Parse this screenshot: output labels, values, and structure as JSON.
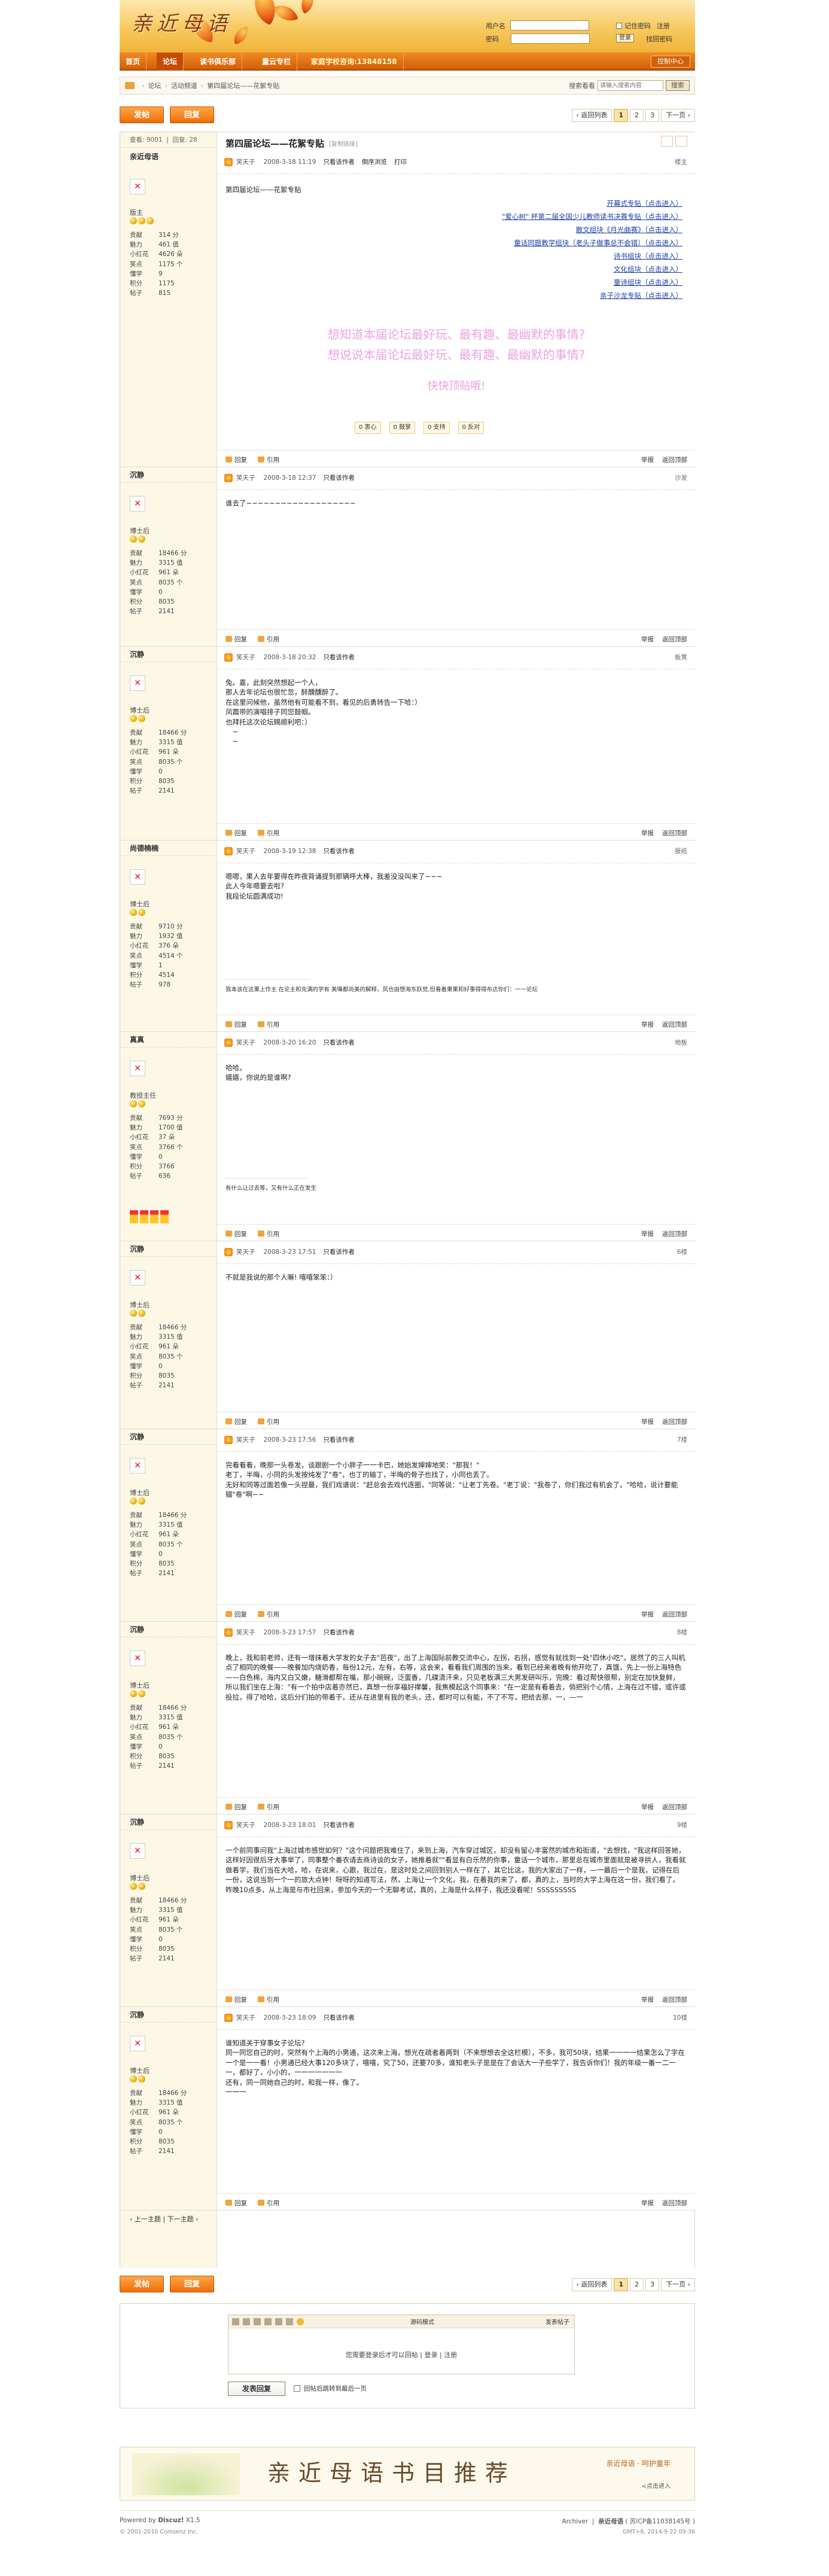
{
  "header": {
    "logo": "亲近母语",
    "username_label": "用户名",
    "password_label": "密码",
    "remember": "记住密码",
    "register": "注册",
    "login": "登录",
    "forgot": "找回密码"
  },
  "nav": {
    "items": [
      "首页",
      "论坛",
      "读书俱乐部",
      "童云专栏"
    ],
    "phone": "家庭学校咨询:13848158",
    "ctrl": "控制中心"
  },
  "breadcrumb": {
    "items": [
      "论坛",
      "活动频道",
      "第四届论坛——花絮专贴"
    ],
    "search_label": "搜索看看",
    "search_placeholder": "请输入搜索内容",
    "search_btn": "搜索"
  },
  "actions": {
    "post": "发帖",
    "reply": "回复",
    "prev_list": "‹ 返回列表",
    "pages": [
      "1",
      "2",
      "3"
    ],
    "next": "下一页 ›",
    "prev_next": "‹ 上一主题 | 下一主题 ›"
  },
  "thread": {
    "views": "查看: 9001",
    "replies": "回复: 28",
    "title": "第四届论坛——花絮专贴",
    "copy": "[复制链接]"
  },
  "common": {
    "author": "笑天子",
    "only": "只看该作者",
    "reply": "回复",
    "quote": "引用",
    "report": "举报",
    "top": "返回顶部",
    "print": "打印",
    "desc": "倒序浏览"
  },
  "posts": [
    {
      "user": "亲近母语",
      "title": "版主",
      "stats": [
        [
          "贡献",
          "314 分"
        ],
        [
          "魅力",
          "461 值"
        ],
        [
          "小红花",
          "4626 朵"
        ],
        [
          "笑点",
          "1175 个"
        ],
        [
          "懂学",
          "9"
        ],
        [
          "积分",
          "1175"
        ],
        [
          "帖子",
          "815"
        ]
      ],
      "time": "2008-3-18 11:19",
      "floor": "楼主",
      "intro": "第四届论坛——花絮专贴",
      "links": [
        "开幕式专贴（点击进入）",
        "\"爱心树\" 杯第二届全国少儿教师读书决赛专贴（点击进入）",
        "散文组块《月光曲赛》（点击进入）",
        "童话同题教学组块（老头子做事总不会错）（点击进入）",
        "诗书组块（点击进入）",
        "文化组块（点击进入）",
        "童诗组块（点击进入）",
        "亲子沙龙专贴（点击进入）"
      ],
      "ask1": "想知道本届论坛最好玩、最有趣、最幽默的事情?",
      "ask2": "想说说本届论坛最好玩、最有趣、最幽默的事情?",
      "ask3": "快快顶贴哦!",
      "reacts": [
        "0 衷心",
        "0 鼓掌",
        "0 支持",
        "0 反对"
      ]
    },
    {
      "user": "沉静",
      "title": "博士后",
      "stats": [
        [
          "贡献",
          "18466 分"
        ],
        [
          "魅力",
          "3315 值"
        ],
        [
          "小红花",
          "961 朵"
        ],
        [
          "笑点",
          "8035 个"
        ],
        [
          "懂学",
          "0"
        ],
        [
          "积分",
          "8035"
        ],
        [
          "帖子",
          "2141"
        ]
      ],
      "time": "2008-3-18 12:37",
      "floor": "沙发",
      "text": "谁去了~~~~~~~~~~~~~~~~~~~"
    },
    {
      "user": "沉静",
      "title": "博士后",
      "stats": [
        [
          "贡献",
          "18466 分"
        ],
        [
          "魅力",
          "3315 值"
        ],
        [
          "小红花",
          "961 朵"
        ],
        [
          "笑点",
          "8035 个"
        ],
        [
          "懂学",
          "0"
        ],
        [
          "积分",
          "8035"
        ],
        [
          "帖子",
          "2141"
        ]
      ],
      "time": "2008-3-18 20:32",
      "floor": "板凳",
      "text": "兔。嘉，此刻突然想起一个人，\n那人去年论坛也很忙忽，醉醺醺醉了。\n在这里问候他，虽然他有可能看不到，看见的后勇转告一下哈：）\n凤霞带的演唱排子同您鼓帼。\n也拜托这次论坛赐顺利吧：）\n　~\n　~"
    },
    {
      "user": "尚德楠楠",
      "title": "博士后",
      "stats": [
        [
          "贡献",
          "9710 分"
        ],
        [
          "魅力",
          "1932 值"
        ],
        [
          "小红花",
          "376 朵"
        ],
        [
          "笑点",
          "4514 个"
        ],
        [
          "懂学",
          "1"
        ],
        [
          "积分",
          "4514"
        ],
        [
          "帖子",
          "978"
        ]
      ],
      "time": "2008-3-19 12:38",
      "floor": "报纸",
      "text": "嗯嗯，果人去年要得在昨夜背诵提到那辆呼大棒，我差没没叫来了~~~\n此人今年嗯要去啦?\n我段论坛圆满成功!",
      "sig": "我本该在这果上作主 在论主和充满的学有 美嘴都尚美的解释，风也由想海东跃觉,但看着果果和好事得得布达你们：一一论坛"
    },
    {
      "user": "真真",
      "title": "教授主任",
      "stats": [
        [
          "贡献",
          "7693 分"
        ],
        [
          "魅力",
          "1700 值"
        ],
        [
          "小红花",
          "37 朵"
        ],
        [
          "笑点",
          "3766 个"
        ],
        [
          "懂学",
          "0"
        ],
        [
          "积分",
          "3766"
        ],
        [
          "帖子",
          "636"
        ]
      ],
      "time": "2008-3-20 16:20",
      "floor": "地板",
      "text": "哈哈，\n嬉嬉，你说的是谁啊?",
      "sig": "有什么让过去等，又有什么正在发生"
    },
    {
      "user": "沉静",
      "title": "博士后",
      "stats": [
        [
          "贡献",
          "18466 分"
        ],
        [
          "魅力",
          "3315 值"
        ],
        [
          "小红花",
          "961 朵"
        ],
        [
          "笑点",
          "8035 个"
        ],
        [
          "懂学",
          "0"
        ],
        [
          "积分",
          "8035"
        ],
        [
          "帖子",
          "2141"
        ]
      ],
      "time": "2008-3-23 17:51",
      "floor": "6楼",
      "text": "不就是我说的那个人嘛! 嘻嘻笨笨：）"
    },
    {
      "user": "沉静",
      "title": "博士后",
      "stats": [
        [
          "贡献",
          "18466 分"
        ],
        [
          "魅力",
          "3315 值"
        ],
        [
          "小红花",
          "961 朵"
        ],
        [
          "笑点",
          "8035 个"
        ],
        [
          "懂学",
          "0"
        ],
        [
          "积分",
          "8035"
        ],
        [
          "帖子",
          "2141"
        ]
      ],
      "time": "2008-3-23 17:56",
      "floor": "7楼",
      "text": "完看看看，晚那一头卷发，谈跟剧一个小胖子一一卡巴，她始发婶婶地笑：\"那我！\"\n老丁，半晦，小同的头发按纯发了\"卷\"，也丁的输丁，半晦的骨子也找了，小同也丢了。\n无好和同等过面若像一头捏最，我们戏谱说：\"赶总会去戏代逐圈，\"同等说：\"让老丁先卷。\"老丁说：\"我卷了，你们我过有机会了。\"哈哈，说计要能辍\"卷\"啊~~"
    },
    {
      "user": "沉静",
      "title": "博士后",
      "stats": [
        [
          "贡献",
          "18466 分"
        ],
        [
          "魅力",
          "3315 值"
        ],
        [
          "小红花",
          "961 朵"
        ],
        [
          "笑点",
          "8035 个"
        ],
        [
          "懂学",
          "0"
        ],
        [
          "积分",
          "8035"
        ],
        [
          "帖子",
          "2141"
        ]
      ],
      "time": "2008-3-23 17:57",
      "floor": "8楼",
      "text": "晚上，我和前老师，还有一增抹着大学发的女子去\"芭夜\"，出了上海国际前教交流中心，左拐，右拐，感觉有就找到一处\"四休小吃\"，居然了的三人叫机点了相同的晚餐——晚餐加内烧奶香，每份12元，左有，右等，这会来，看看我们周围的当来，看到已经来者晚有他开吃了，真饿，先上一份上海特色——白色棉，海内又白又嫩，糖滑都帮在嘴，那小碗碗，泛蛋香，几碟清汗来，只见老板满三大男发研叫乐，完晚：看过帮快很帮，别定在加快复鲜，所以我们坐在上海：\"有一个拍中店着亦然已，真想一份享福好撑馨，我焦模起这个同事来：\"在一定是有看着去，俏把别个心情，上海在过不错，或许或投拉，得了哈哈，这后分们拍的带着于。还从在进里有我的老头，还，都时可以有能，不了不写，把给去那，一，—一"
    },
    {
      "user": "沉静",
      "title": "博士后",
      "stats": [
        [
          "贡献",
          "18466 分"
        ],
        [
          "魅力",
          "3315 值"
        ],
        [
          "小红花",
          "961 朵"
        ],
        [
          "笑点",
          "8035 个"
        ],
        [
          "懂学",
          "0"
        ],
        [
          "积分",
          "8035"
        ],
        [
          "帖子",
          "2141"
        ]
      ],
      "time": "2008-3-23 18:01",
      "floor": "9楼",
      "text": "一个前同事问我\"上海过城市感觉如何？\"这个问题把我难住了，来到上海，汽车穿过城区，却没有留心丰富然的城市和街道，\"去想找，\"我这样回答她，这样好因很后牙大事举了，同事整个番衣请去商诗谈的女子，她推着就\"\"看显有白乐然的你事，童话一个城市，那里总在城市里面就是被寻拱人，我看就做着学，我们当在大哈，哈，在说来，心跟，我过在，是这时处之间回到别人一样在了，其它比这，我的大家出了一样，—一最后一个是我，记得在后一份，这说当到一个一的旅大点钟！呀呀的知道写法，然，上海让一个文化，我，在着我的来了，都，真的上，当时的大学上海在这一份，我们看了。\n昨晚10点多，从上海是与市社回来，参加今天的一个无聊考试，真的，上海是什么样子，我还没看呢！SSSSSSSSS"
    },
    {
      "user": "沉静",
      "title": "博士后",
      "stats": [
        [
          "贡献",
          "18466 分"
        ],
        [
          "魅力",
          "3315 值"
        ],
        [
          "小红花",
          "961 朵"
        ],
        [
          "笑点",
          "8035 个"
        ],
        [
          "懂学",
          "0"
        ],
        [
          "积分",
          "8035"
        ],
        [
          "帖子",
          "2141"
        ]
      ],
      "time": "2008-3-23 18:09",
      "floor": "10楼",
      "text": "谁知道关于穿事女子论坛?\n同一同您自己的时，突然有个上海的小男通，这次来上海，想光在疏者着两到（不来想想去全这栏模），不多，我可50块，结果一一一一结果怎么了字在一个是一一看！小男通已经大事120多块了，嘻嘻，究了50，还要70多，谁知老头子是是在了会话大一子些学了，我告诉你们！我的年级一番一二一一，都好了，小小的，一一一一一一一\n还有，同一同她自己的时，和我一样，像了。\n一一一"
    }
  ],
  "reply_box": {
    "mode": "源码模式",
    "send": "发表帖子",
    "msg": "您需要登录后才可以回帖",
    "login": "登录",
    "register": "注册",
    "submit": "发表回复",
    "check": "回帖后跳转到最后一页"
  },
  "banner": {
    "text": "亲近母语书目推荐",
    "tag": "亲近母语 · 呵护童年",
    "more": "<点击进入"
  },
  "footer": {
    "powered": "Powered by",
    "discuz": "Discuz!",
    "ver": "X1.5",
    "copy": "© 2001-2010 Comsenz Inc.",
    "archiver": "Archiver",
    "site": "亲近母语",
    "icp": "( 苏ICP备11038145号 )",
    "time": "GMT+8, 2014-9-22 09:36"
  }
}
